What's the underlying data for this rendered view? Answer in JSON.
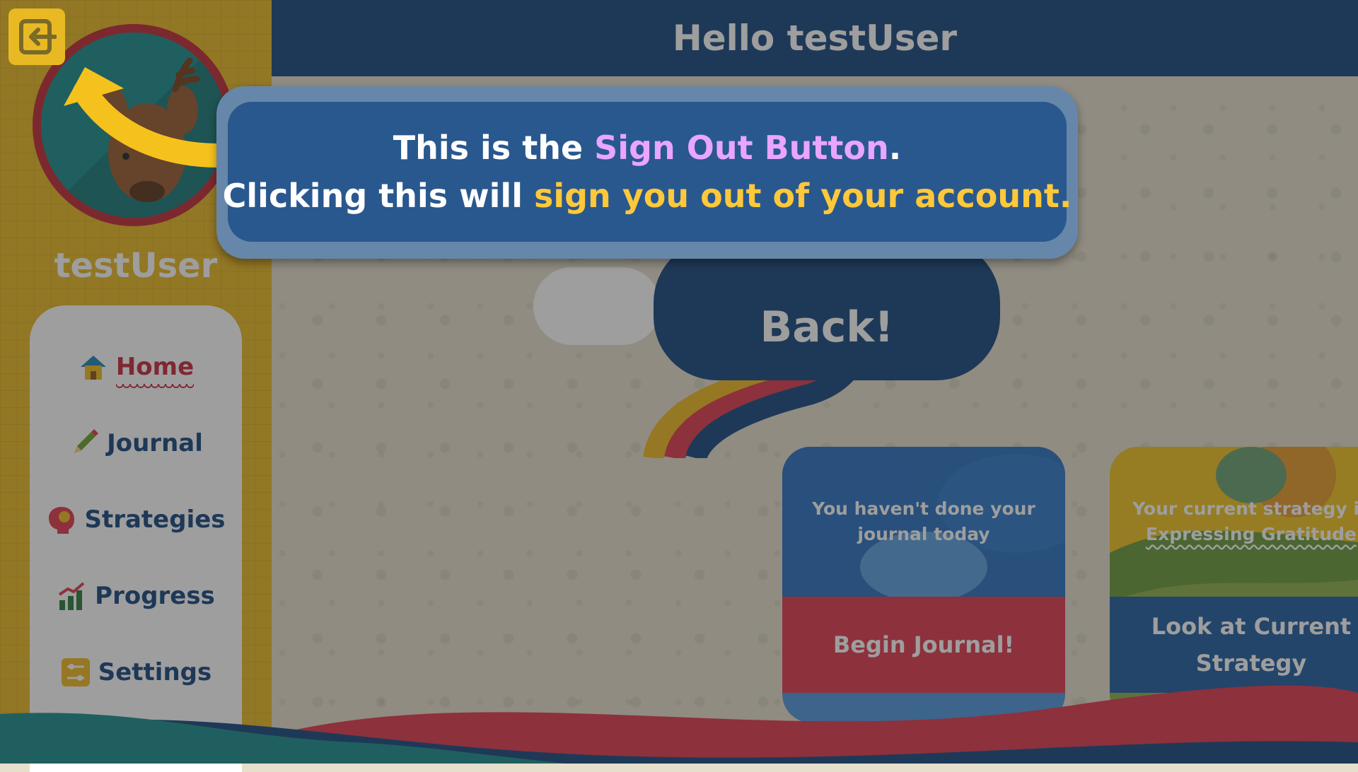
{
  "header": {
    "greeting": "Hello testUser"
  },
  "sidebar": {
    "username": "testUser",
    "items": [
      {
        "label": "Home",
        "icon": "home-icon",
        "active": true
      },
      {
        "label": "Journal",
        "icon": "pencil-icon"
      },
      {
        "label": "Strategies",
        "icon": "head-icon"
      },
      {
        "label": "Progress",
        "icon": "bar-chart-icon"
      },
      {
        "label": "Settings",
        "icon": "sliders-icon"
      }
    ],
    "signout_icon": "sign-out-icon",
    "avatar_icon": "deer-icon"
  },
  "main": {
    "welcome_text": "Back!",
    "journal_card": {
      "status_text": "You haven't done your journal today",
      "button_label": "Begin Journal!"
    },
    "strategy_card": {
      "status_prefix": "Your current strategy is",
      "strategy_name": "Expressing Gratitude",
      "button_label": "Look at Current Strategy"
    }
  },
  "tooltip": {
    "line1_prefix": "This is the ",
    "line1_highlight": "Sign Out Button",
    "line1_suffix": ".",
    "line2_prefix": "Clicking this will ",
    "line2_highlight": "sign you out of your account."
  },
  "colors": {
    "header_blue": "#17477f",
    "sidebar_yellow": "#e9b923",
    "accent_red": "#c7283b",
    "highlight_pink": "#e9a5ff",
    "highlight_yellow": "#ffc83a"
  }
}
